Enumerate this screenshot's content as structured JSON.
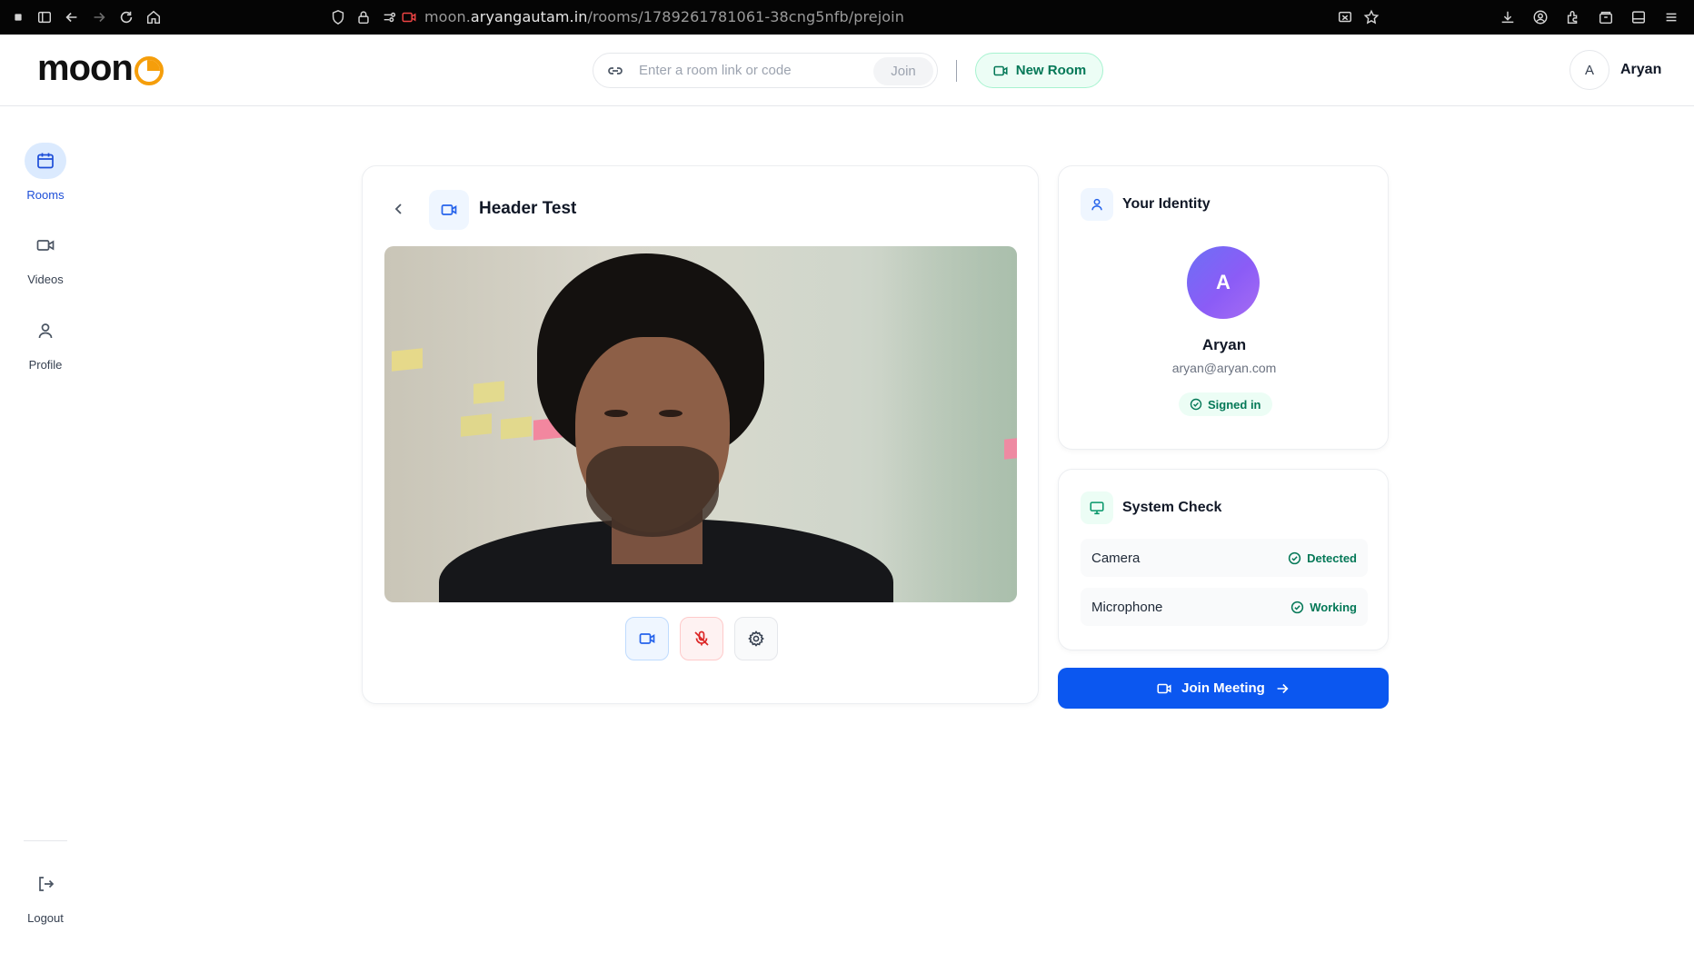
{
  "browser": {
    "url_prefix": "moon.",
    "url_host": "aryangautam.in",
    "url_path": "/rooms/1789261781061-38cng5nfb/prejoin"
  },
  "header": {
    "logo_text": "moon",
    "search_placeholder": "Enter a room link or code",
    "join_label": "Join",
    "new_room_label": "New Room",
    "user_initial": "A",
    "user_name": "Aryan"
  },
  "sidebar": {
    "items": [
      {
        "label": "Rooms",
        "icon": "calendar-icon"
      },
      {
        "label": "Videos",
        "icon": "video-icon"
      },
      {
        "label": "Profile",
        "icon": "user-icon"
      }
    ],
    "logout_label": "Logout"
  },
  "room": {
    "title": "Header Test",
    "camera_on": true,
    "mic_muted": true
  },
  "identity": {
    "heading": "Your Identity",
    "initial": "A",
    "name": "Aryan",
    "email": "aryan@aryan.com",
    "status": "Signed in"
  },
  "system_check": {
    "heading": "System Check",
    "items": [
      {
        "label": "Camera",
        "status": "Detected"
      },
      {
        "label": "Microphone",
        "status": "Working"
      }
    ]
  },
  "join_meeting_label": "Join Meeting",
  "colors": {
    "accent": "#0b57f0",
    "success": "#047857",
    "logo_orange": "#f59e0b",
    "danger": "#dc2626"
  }
}
